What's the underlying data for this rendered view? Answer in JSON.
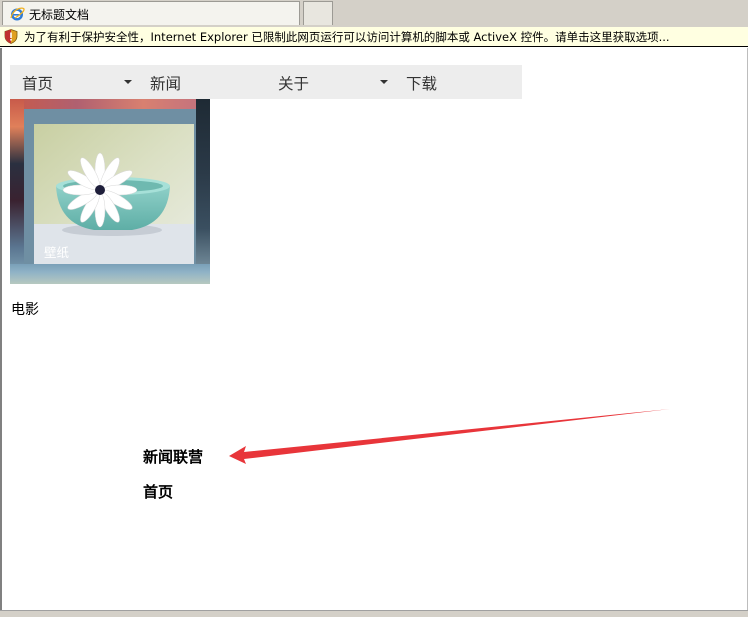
{
  "browser": {
    "tab_title": "无标题文档",
    "infobar_message": "为了有利于保护安全性，Internet Explorer 已限制此网页运行可以访问计算机的脚本或 ActiveX 控件。请单击这里获取选项..."
  },
  "nav": {
    "items": [
      {
        "label": "首页",
        "has_dropdown": true
      },
      {
        "label": "新闻",
        "has_dropdown": false
      },
      {
        "label": "关于",
        "has_dropdown": true
      },
      {
        "label": "下载",
        "has_dropdown": false
      }
    ]
  },
  "gallery": {
    "caption": "壁纸"
  },
  "section_label": "电影",
  "annotations": {
    "arrow_target_label": "新闻联营",
    "second_label": "首页",
    "arrow_color": "#e8353a"
  },
  "colors": {
    "nav_background": "#ededed",
    "infobar_background": "#ffffe1"
  }
}
